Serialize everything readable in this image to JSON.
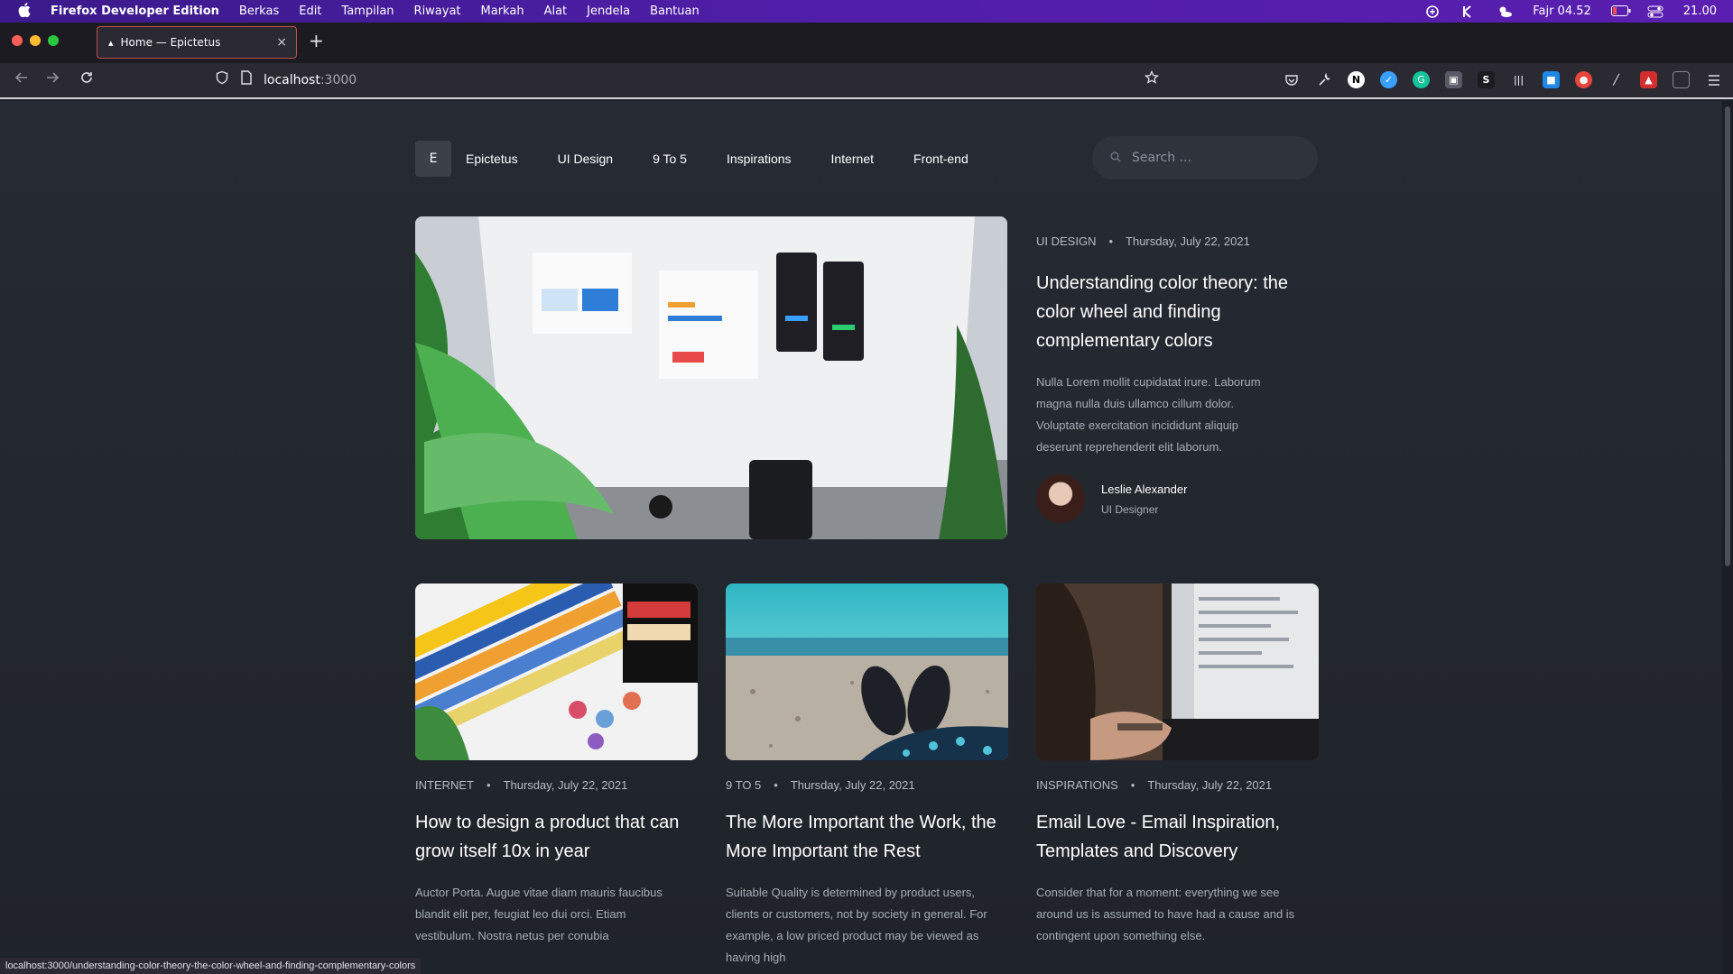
{
  "menubar": {
    "app_name": "Firefox Developer Edition",
    "items": [
      "Berkas",
      "Edit",
      "Tampilan",
      "Riwayat",
      "Markah",
      "Alat",
      "Jendela",
      "Bantuan"
    ],
    "prayer_time": "Fajr 04.52",
    "clock": "21.00"
  },
  "browser": {
    "tab_title": "Home — Epictetus",
    "tab_close": "×",
    "new_tab": "+",
    "url_host": "localhost",
    "url_port": ":3000",
    "status_url": "localhost:3000/understanding-color-theory-the-color-wheel-and-finding-complementary-colors"
  },
  "site": {
    "logo_letter": "E",
    "nav": [
      "Epictetus",
      "UI Design",
      "9 To 5",
      "Inspirations",
      "Internet",
      "Front-end"
    ],
    "search_placeholder": "Search ..."
  },
  "hero": {
    "category": "UI DESIGN",
    "dot": "•",
    "date": "Thursday, July 22, 2021",
    "title": "Understanding color theory: the color wheel and finding complementary colors",
    "excerpt": "Nulla Lorem mollit cupidatat irure. Laborum magna nulla duis ullamco cillum dolor. Voluptate exercitation incididunt aliquip deserunt reprehenderit elit laborum.",
    "author_name": "Leslie Alexander",
    "author_role": "UI Designer"
  },
  "cards": [
    {
      "category": "INTERNET",
      "date": "Thursday, July 22, 2021",
      "title": "How to design a product that can grow itself 10x in year",
      "excerpt": "Auctor Porta. Augue vitae diam mauris faucibus blandit elit per, feugiat leo dui orci. Etiam vestibulum. Nostra netus per conubia"
    },
    {
      "category": "9 TO 5",
      "date": "Thursday, July 22, 2021",
      "title": "The More Important the Work, the More Important the Rest",
      "excerpt": "Suitable Quality is determined by product users, clients or customers, not by society in general. For example, a low priced product may be viewed as having high"
    },
    {
      "category": "INSPIRATIONS",
      "date": "Thursday, July 22, 2021",
      "title": "Email Love - Email Inspiration, Templates and Discovery",
      "excerpt": "Consider that for a moment: everything we see around us is assumed to have had a cause and is contingent upon something else."
    }
  ],
  "colors": {
    "menubar": "#4f1ea8",
    "tab_border": "#c0504d",
    "page_bg": "#262a32"
  }
}
